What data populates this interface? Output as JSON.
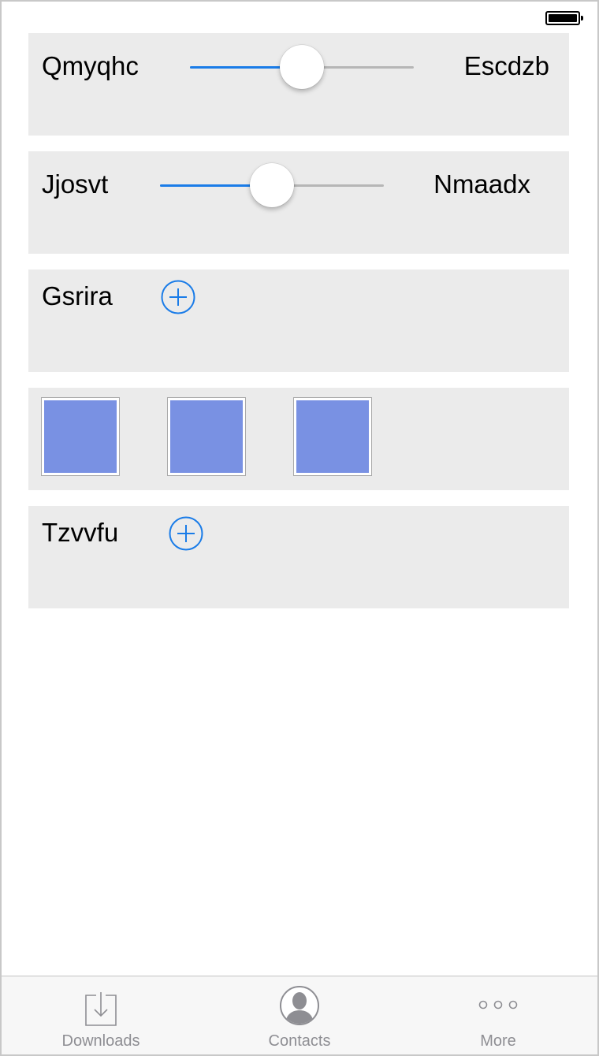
{
  "status_bar": {
    "battery_level_percent": 100
  },
  "rows": [
    {
      "type": "slider",
      "left_label": "Qmyqhc",
      "right_label": "Escdzb",
      "value_fraction": 0.5
    },
    {
      "type": "slider",
      "left_label": "Jjosvt",
      "right_label": "Nmaadx",
      "value_fraction": 0.5
    },
    {
      "type": "add",
      "label": "Gsrira",
      "button_icon": "plus-circle-icon"
    },
    {
      "type": "images",
      "tile_count": 3,
      "tile_color": "#7991e3"
    },
    {
      "type": "add",
      "label": "Tzvvfu",
      "button_icon": "plus-circle-icon"
    }
  ],
  "tabbar": {
    "tabs": [
      {
        "label": "Downloads",
        "icon": "download-tray-icon"
      },
      {
        "label": "Contacts",
        "icon": "contact-silhouette-icon"
      },
      {
        "label": "More",
        "icon": "more-dots-icon"
      }
    ]
  },
  "colors": {
    "accent": "#1a7ce8",
    "card_background": "#ebebeb",
    "tab_inactive": "#8e8e93"
  }
}
